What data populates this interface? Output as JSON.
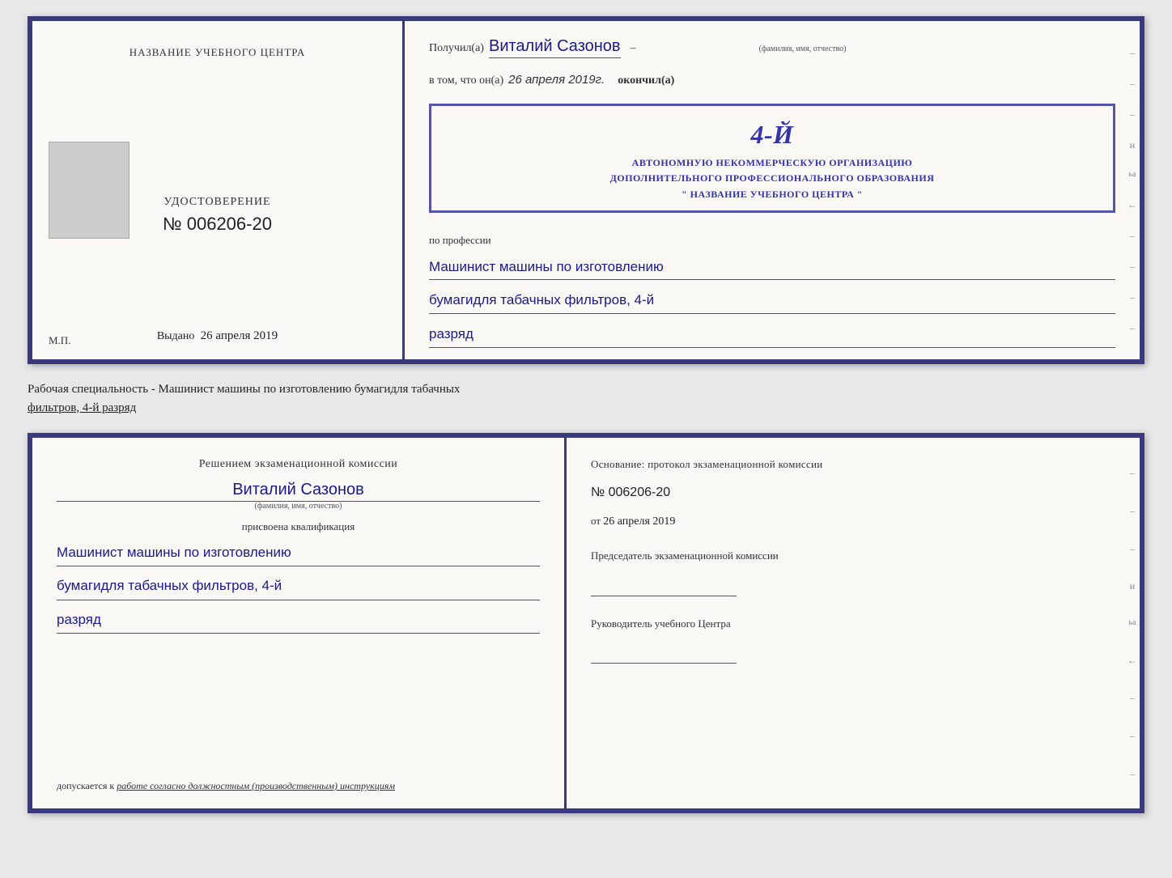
{
  "top_cert": {
    "left": {
      "title": "НАЗВАНИЕ УЧЕБНОГО ЦЕНТРА",
      "udost": "УДОСТОВЕРЕНИЕ",
      "number": "№ 006206-20",
      "issued_label": "Выдано",
      "issued_date": "26 апреля 2019",
      "mp": "М.П."
    },
    "right": {
      "received_label": "Получил(а)",
      "name": "Виталий Сазонов",
      "name_sub": "(фамилия, имя, отчество)",
      "vtom_label": "в том, что он(а)",
      "date_handwritten": "26 апреля 2019г.",
      "okonchil": "окончил(а)",
      "stamp_line1": "4-й",
      "stamp_line2": "АВТОНОМНУЮ НЕКОММЕРЧЕСКУЮ ОРГАНИЗАЦИЮ",
      "stamp_line3": "ДОПОЛНИТЕЛЬНОГО ПРОФЕССИОНАЛЬНОГО ОБРАЗОВАНИЯ",
      "stamp_line4": "\" НАЗВАНИЕ УЧЕБНОГО ЦЕНТРА \"",
      "po_professii": "по профессии",
      "profession1": "Машинист машины по изготовлению",
      "profession2": "бумагидля табачных фильтров, 4-й",
      "profession3": "разряд"
    }
  },
  "label_between": {
    "text_normal": "Рабочая специальность - Машинист машины по изготовлению бумагидля табачных",
    "text_underline": "фильтров, 4-й разряд"
  },
  "bottom_cert": {
    "left": {
      "resheniem": "Решением экзаменационной комиссии",
      "name": "Виталий Сазонов",
      "name_sub": "(фамилия, имя, отчество)",
      "prisvoena": "присвоена квалификация",
      "qualification1": "Машинист машины по изготовлению",
      "qualification2": "бумагидля табачных фильтров, 4-й",
      "qualification3": "разряд",
      "dopuskaetsya_label": "допускается к",
      "dopuskaetsya_val": "работе согласно должностным (производственным) инструкциям"
    },
    "right": {
      "osnov_label": "Основание: протокол экзаменационной комиссии",
      "prot_number": "№  006206-20",
      "prot_ot": "от",
      "prot_date": "26 апреля 2019",
      "chairman": "Председатель экзаменационной комиссии",
      "rukov": "Руководитель учебного Центра"
    }
  },
  "dashes": [
    "–",
    "–",
    "–",
    "и",
    "ьа",
    "←",
    "–",
    "–",
    "–",
    "–",
    "–"
  ]
}
